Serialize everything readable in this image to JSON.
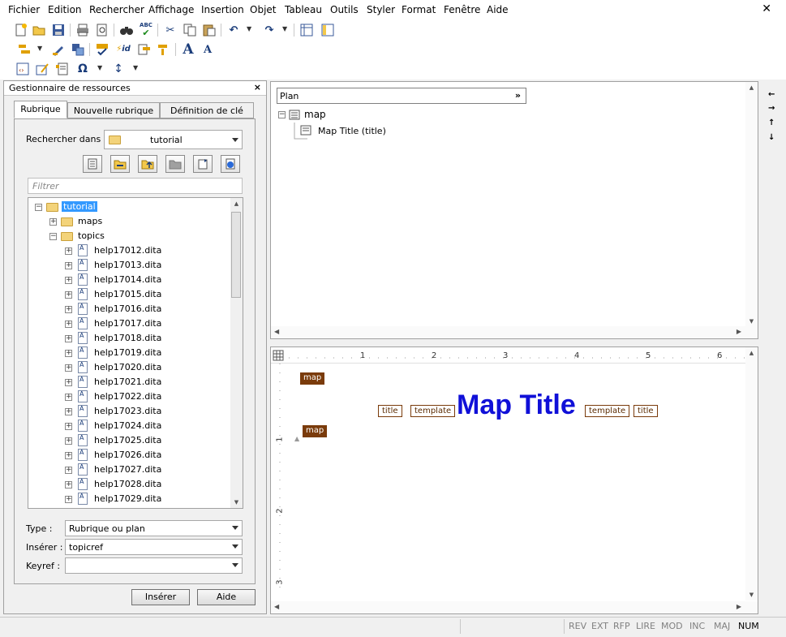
{
  "menubar": {
    "items": [
      "Fichier",
      "Edition",
      "Rechercher",
      "Affichage",
      "Insertion",
      "Objet",
      "Tableau",
      "Outils",
      "Styler",
      "Format",
      "Fenêtre",
      "Aide"
    ],
    "close_glyph": "✕"
  },
  "toolbar": {
    "spell_label": "ABC",
    "id_label": "id",
    "font_large_label": "A",
    "font_small_label": "A",
    "omega_label": "Ω"
  },
  "resource_manager": {
    "title": "Gestionnaire de ressources",
    "close_glyph": "×",
    "tabs": [
      "Rubrique",
      "Nouvelle rubrique",
      "Définition de clé"
    ],
    "search_in_label": "Rechercher dans :",
    "search_in_value": "tutorial",
    "filter_placeholder": "Filtrer",
    "tree": {
      "root": "tutorial",
      "folders": [
        "maps",
        "topics"
      ],
      "files": [
        "help17012.dita",
        "help17013.dita",
        "help17014.dita",
        "help17015.dita",
        "help17016.dita",
        "help17017.dita",
        "help17018.dita",
        "help17019.dita",
        "help17020.dita",
        "help17021.dita",
        "help17022.dita",
        "help17023.dita",
        "help17024.dita",
        "help17025.dita",
        "help17026.dita",
        "help17027.dita",
        "help17028.dita",
        "help17029.dita"
      ]
    },
    "type_label": "Type :",
    "type_value": "Rubrique ou plan",
    "insert_label": "Insérer :",
    "insert_value": "topicref",
    "keyref_label": "Keyref :",
    "keyref_value": "",
    "insert_button": "Insérer",
    "help_button": "Aide"
  },
  "plan": {
    "title": "Plan",
    "more_glyph": "»",
    "nodes": {
      "map": "map",
      "map_title": "Map Title (title)"
    }
  },
  "side_nav": {
    "arrows": [
      "←",
      "→",
      "↑",
      "↓"
    ]
  },
  "editor": {
    "ruler_numbers": [
      "1",
      "2",
      "3",
      "4",
      "5",
      "6"
    ],
    "vruler_numbers": [
      "1",
      "2",
      "3"
    ],
    "tags": {
      "map_open": "map",
      "title_open": "title",
      "template_open": "template",
      "template_close": "template",
      "title_close": "title",
      "map_close": "map"
    },
    "content": "Map Title",
    "content_color": "#1010d8",
    "tag_color": "#7a3b0b"
  },
  "statusbar": {
    "indicators": [
      "REV",
      "EXT",
      "RFP",
      "LIRE",
      "MOD",
      "INC",
      "MAJ",
      "NUM"
    ],
    "active": "NUM"
  }
}
